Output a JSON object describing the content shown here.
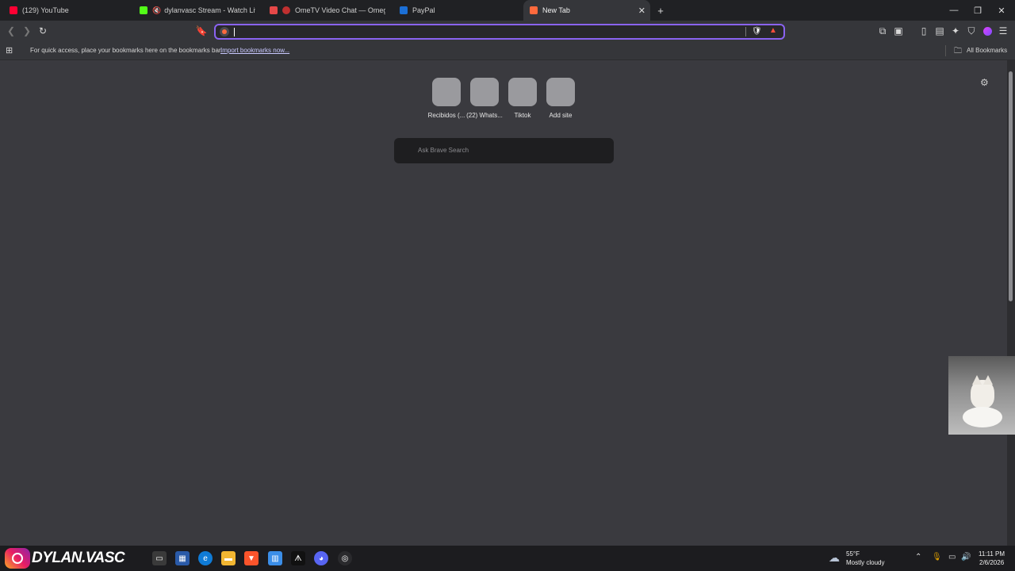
{
  "tabs": [
    {
      "title": "(129) YouTube",
      "color": "#ff0033",
      "active": false
    },
    {
      "title": "dylanvasc Stream - Watch Live on",
      "color": "#53fc18",
      "active": false
    },
    {
      "title": "OmeTV Video Chat — Omegle Ra",
      "color": "#e64848",
      "active": false
    },
    {
      "title": "PayPal",
      "color": "#1b6fd6",
      "active": false
    },
    {
      "title": "New Tab",
      "color": "#ff6a3d",
      "active": true
    }
  ],
  "omnibox": {
    "value": ""
  },
  "bookmarks_bar": {
    "hint": "For quick access, place your bookmarks here on the bookmarks bar.",
    "import_link": "Import bookmarks now...",
    "all_bookmarks": "All Bookmarks"
  },
  "top_sites": [
    {
      "label": "Recibidos (..."
    },
    {
      "label": "(22) Whats..."
    },
    {
      "label": "Tiktok"
    },
    {
      "label": "Add site"
    }
  ],
  "search": {
    "placeholder": "Ask Brave Search"
  },
  "taskbar": {
    "overlay_text": "DYLAN.VASC",
    "weather_temp": "55°F",
    "weather_desc": "Mostly cloudy",
    "time": "11:11 PM",
    "date": "2/6/2026"
  },
  "colors": {
    "accent": "#8a63f1",
    "background": "#3a3a3f",
    "toolbar": "#35363a"
  }
}
